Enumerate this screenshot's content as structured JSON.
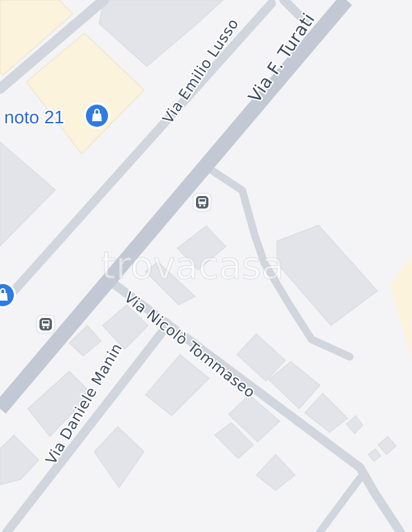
{
  "map": {
    "watermark": "trovacasa",
    "colors": {
      "background": "#f4f4f6",
      "major_road": "#c2c8d4",
      "minor_road": "#d0d5de",
      "building": "#e3e4e9",
      "commercial_area": "#fbf3dc",
      "poi_blue": "#2f7be0",
      "label_text": "#3c4a5c",
      "poi_text": "#2a6ad6"
    },
    "streets": [
      {
        "name": "Via F. Turati",
        "class": "major"
      },
      {
        "name": "Via Emilio Lusso",
        "class": "minor"
      },
      {
        "name": "Via Nicolò Tommaseo",
        "class": "minor"
      },
      {
        "name": "Via Daniele Manin",
        "class": "minor"
      }
    ],
    "pois": [
      {
        "label": "noto 21",
        "icon": "shopping-bag-icon"
      },
      {
        "label": "",
        "icon": "shopping-bag-icon"
      }
    ],
    "transit": [
      {
        "icon": "bus-stop-icon"
      },
      {
        "icon": "bus-stop-icon"
      }
    ]
  }
}
